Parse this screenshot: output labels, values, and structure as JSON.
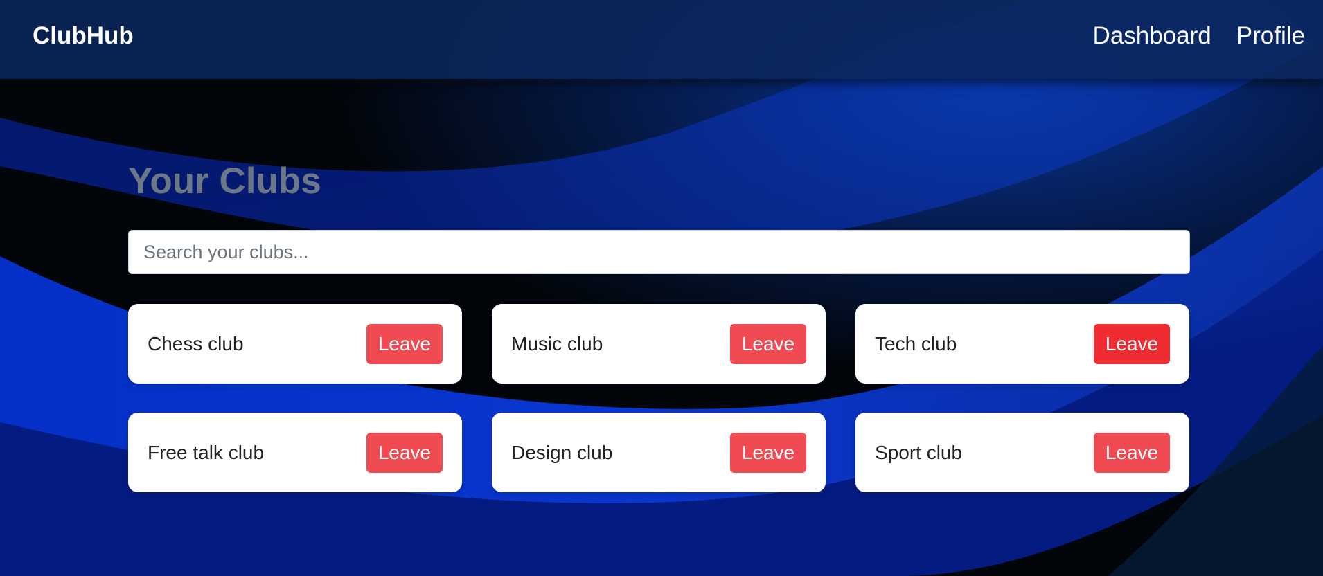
{
  "navbar": {
    "brand": "ClubHub",
    "links": [
      "Dashboard",
      "Profile"
    ]
  },
  "page": {
    "title": "Your Clubs"
  },
  "search": {
    "placeholder": "Search your clubs...",
    "value": ""
  },
  "clubs": [
    {
      "name": "Chess club",
      "action": "Leave"
    },
    {
      "name": "Music club",
      "action": "Leave"
    },
    {
      "name": "Tech club",
      "action": "Leave"
    },
    {
      "name": "Free talk club",
      "action": "Leave"
    },
    {
      "name": "Design club",
      "action": "Leave"
    },
    {
      "name": "Sport club",
      "action": "Leave"
    }
  ],
  "colors": {
    "navbar": "#0c285c",
    "title": "#6c7787",
    "leave_button": "#f04a52",
    "leave_button_hover": "#f02c33",
    "background_wave": "#0a35c8",
    "background_dark": "#020509"
  }
}
